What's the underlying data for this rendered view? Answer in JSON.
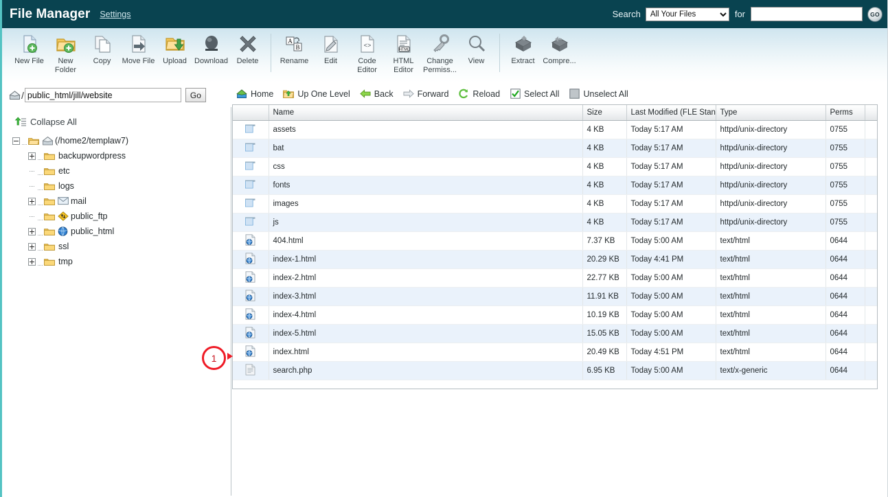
{
  "header": {
    "title": "File Manager",
    "settings_label": "Settings",
    "search_label": "Search",
    "search_scope_selected": "All Your Files",
    "search_scope_options": [
      "All Your Files"
    ],
    "for_label": "for",
    "search_value": "",
    "search_placeholder": "",
    "go_button": "GO",
    "bg_color": "#094350"
  },
  "toolbar": {
    "items": [
      {
        "label": "New File",
        "icon": "new-file-icon"
      },
      {
        "label": "New Folder",
        "icon": "new-folder-icon"
      },
      {
        "label": "Copy",
        "icon": "copy-icon"
      },
      {
        "label": "Move File",
        "icon": "move-file-icon"
      },
      {
        "label": "Upload",
        "icon": "upload-icon"
      },
      {
        "label": "Download",
        "icon": "download-icon"
      },
      {
        "label": "Delete",
        "icon": "delete-icon"
      },
      {
        "label": "Rename",
        "icon": "rename-icon"
      },
      {
        "label": "Edit",
        "icon": "edit-icon"
      },
      {
        "label": "Code Editor",
        "icon": "code-editor-icon"
      },
      {
        "label": "HTML Editor",
        "icon": "html-editor-icon"
      },
      {
        "label": "Change Permiss...",
        "icon": "change-permissions-icon"
      },
      {
        "label": "View",
        "icon": "view-icon"
      },
      {
        "label": "Extract",
        "icon": "extract-icon"
      },
      {
        "label": "Compre...",
        "icon": "compress-icon"
      }
    ]
  },
  "pathbar": {
    "home_icon": "home-icon",
    "slash": "/",
    "path_value": "public_html/jill/website",
    "go_label": "Go"
  },
  "sidebar": {
    "collapse_all_label": "Collapse All",
    "root": {
      "label": "(/home2/templaw7)",
      "toggle": "minus"
    },
    "items": [
      {
        "label": "backupwordpress",
        "toggle": "plus",
        "badge": ""
      },
      {
        "label": "etc",
        "toggle": "none",
        "badge": ""
      },
      {
        "label": "logs",
        "toggle": "none",
        "badge": ""
      },
      {
        "label": "mail",
        "toggle": "plus",
        "badge": "mail-icon"
      },
      {
        "label": "public_ftp",
        "toggle": "none",
        "badge": "ftp-icon"
      },
      {
        "label": "public_html",
        "toggle": "plus",
        "badge": "globe-icon"
      },
      {
        "label": "ssl",
        "toggle": "plus",
        "badge": ""
      },
      {
        "label": "tmp",
        "toggle": "plus",
        "badge": ""
      }
    ]
  },
  "navbar": {
    "items": [
      {
        "label": "Home",
        "icon": "home-icon"
      },
      {
        "label": "Up One Level",
        "icon": "up-one-level-icon"
      },
      {
        "label": "Back",
        "icon": "back-arrow-icon"
      },
      {
        "label": "Forward",
        "icon": "forward-arrow-icon"
      },
      {
        "label": "Reload",
        "icon": "reload-icon"
      },
      {
        "label": "Select All",
        "icon": "checked-box-icon"
      },
      {
        "label": "Unselect All",
        "icon": "empty-box-icon"
      }
    ]
  },
  "file_table": {
    "columns": [
      "",
      "Name",
      "Size",
      "Last Modified (FLE Stand",
      "Type",
      "Perms",
      ""
    ],
    "rows": [
      {
        "icon": "folder-icon",
        "name": "assets",
        "size": "4 KB",
        "modified": "Today 5:17 AM",
        "type": "httpd/unix-directory",
        "perms": "0755"
      },
      {
        "icon": "folder-icon",
        "name": "bat",
        "size": "4 KB",
        "modified": "Today 5:17 AM",
        "type": "httpd/unix-directory",
        "perms": "0755"
      },
      {
        "icon": "folder-icon",
        "name": "css",
        "size": "4 KB",
        "modified": "Today 5:17 AM",
        "type": "httpd/unix-directory",
        "perms": "0755"
      },
      {
        "icon": "folder-icon",
        "name": "fonts",
        "size": "4 KB",
        "modified": "Today 5:17 AM",
        "type": "httpd/unix-directory",
        "perms": "0755"
      },
      {
        "icon": "folder-icon",
        "name": "images",
        "size": "4 KB",
        "modified": "Today 5:17 AM",
        "type": "httpd/unix-directory",
        "perms": "0755"
      },
      {
        "icon": "folder-icon",
        "name": "js",
        "size": "4 KB",
        "modified": "Today 5:17 AM",
        "type": "httpd/unix-directory",
        "perms": "0755"
      },
      {
        "icon": "html-file-icon",
        "name": "404.html",
        "size": "7.37 KB",
        "modified": "Today 5:00 AM",
        "type": "text/html",
        "perms": "0644"
      },
      {
        "icon": "html-file-icon",
        "name": "index-1.html",
        "size": "20.29 KB",
        "modified": "Today 4:41 PM",
        "type": "text/html",
        "perms": "0644"
      },
      {
        "icon": "html-file-icon",
        "name": "index-2.html",
        "size": "22.77 KB",
        "modified": "Today 5:00 AM",
        "type": "text/html",
        "perms": "0644"
      },
      {
        "icon": "html-file-icon",
        "name": "index-3.html",
        "size": "11.91 KB",
        "modified": "Today 5:00 AM",
        "type": "text/html",
        "perms": "0644"
      },
      {
        "icon": "html-file-icon",
        "name": "index-4.html",
        "size": "10.19 KB",
        "modified": "Today 5:00 AM",
        "type": "text/html",
        "perms": "0644"
      },
      {
        "icon": "html-file-icon",
        "name": "index-5.html",
        "size": "15.05 KB",
        "modified": "Today 5:00 AM",
        "type": "text/html",
        "perms": "0644"
      },
      {
        "icon": "html-file-icon",
        "name": "index.html",
        "size": "20.49 KB",
        "modified": "Today 4:51 PM",
        "type": "text/html",
        "perms": "0644"
      },
      {
        "icon": "generic-file-icon",
        "name": "search.php",
        "size": "6.95 KB",
        "modified": "Today 5:00 AM",
        "type": "text/x-generic",
        "perms": "0644"
      }
    ]
  },
  "annotation": {
    "number": "1",
    "color": "#ef1b26"
  }
}
